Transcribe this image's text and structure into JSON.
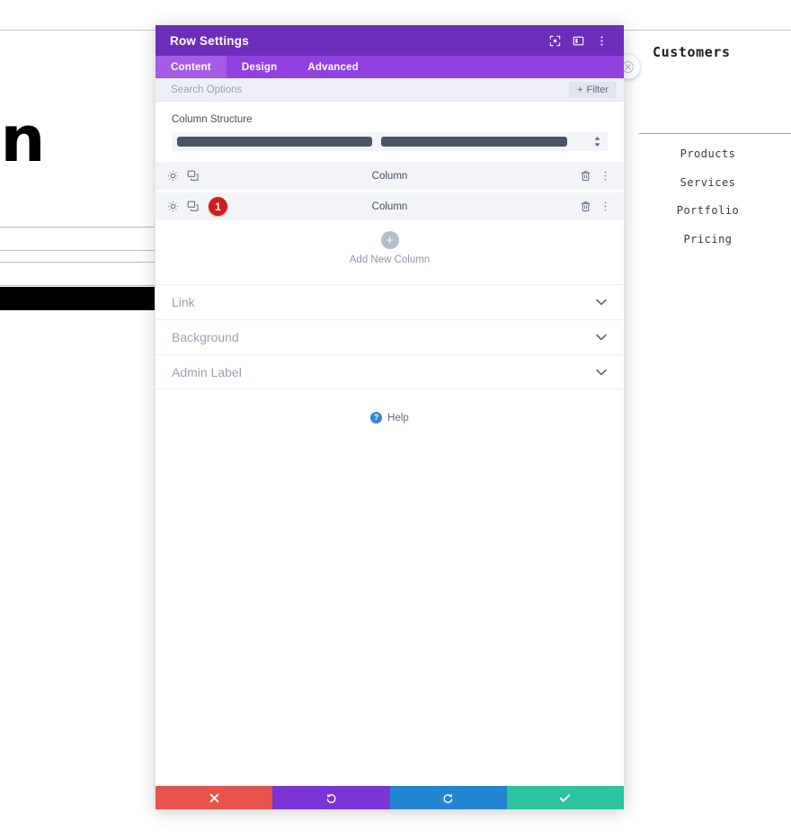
{
  "underlying_page": {
    "left": {
      "big_text": "en",
      "black_bar": true
    },
    "right": {
      "title": "Customers",
      "nav_items": [
        {
          "label": "Products"
        },
        {
          "label": "Services"
        },
        {
          "label": "Portfolio"
        },
        {
          "label": "Pricing"
        }
      ]
    },
    "close_button_icon": "close-icon"
  },
  "modal": {
    "title": "Row Settings",
    "header_icons": [
      {
        "name": "fullscreen-icon"
      },
      {
        "name": "layout-panel-icon"
      },
      {
        "name": "more-vertical-icon"
      }
    ],
    "tabs": [
      {
        "label": "Content",
        "active": true
      },
      {
        "label": "Design",
        "active": false
      },
      {
        "label": "Advanced",
        "active": false
      }
    ],
    "search": {
      "placeholder": "Search Options",
      "value": ""
    },
    "filter_button": {
      "label": "Filter",
      "plus": "+"
    },
    "column_structure": {
      "label": "Column Structure",
      "bars": [
        {
          "width_pct": 50
        },
        {
          "width_pct": 50
        }
      ],
      "stepper_icon": "updown-stepper-icon"
    },
    "columns": [
      {
        "title": "Column",
        "badge": null,
        "settings_icon": "gear-icon",
        "duplicate_icon": "duplicate-icon",
        "delete_icon": "trash-icon",
        "more_icon": "more-vertical-icon"
      },
      {
        "title": "Column",
        "badge": "1",
        "settings_icon": "gear-icon",
        "duplicate_icon": "duplicate-icon",
        "delete_icon": "trash-icon",
        "more_icon": "more-vertical-icon"
      }
    ],
    "add_new_column": {
      "label": "Add New Column",
      "plus": "+"
    },
    "sections": [
      {
        "label": "Link"
      },
      {
        "label": "Background"
      },
      {
        "label": "Admin Label"
      }
    ],
    "help": {
      "label": "Help",
      "icon_char": "?"
    },
    "footer_buttons": [
      {
        "name": "cancel-button",
        "icon": "x-icon"
      },
      {
        "name": "undo-button",
        "icon": "undo-icon"
      },
      {
        "name": "redo-button",
        "icon": "redo-icon"
      },
      {
        "name": "save-button",
        "icon": "check-icon"
      }
    ]
  },
  "colors": {
    "header_purple": "#6c2eb9",
    "tabs_purple": "#9340e0",
    "tab_active_purple": "#a55be6",
    "badge_red": "#d41b1b",
    "structure_bar": "#4a5568",
    "cancel_red": "#e8534c",
    "undo_purple": "#7b35d6",
    "redo_blue": "#2285cf",
    "save_teal": "#2ec2a0",
    "help_blue": "#2e87d6"
  }
}
